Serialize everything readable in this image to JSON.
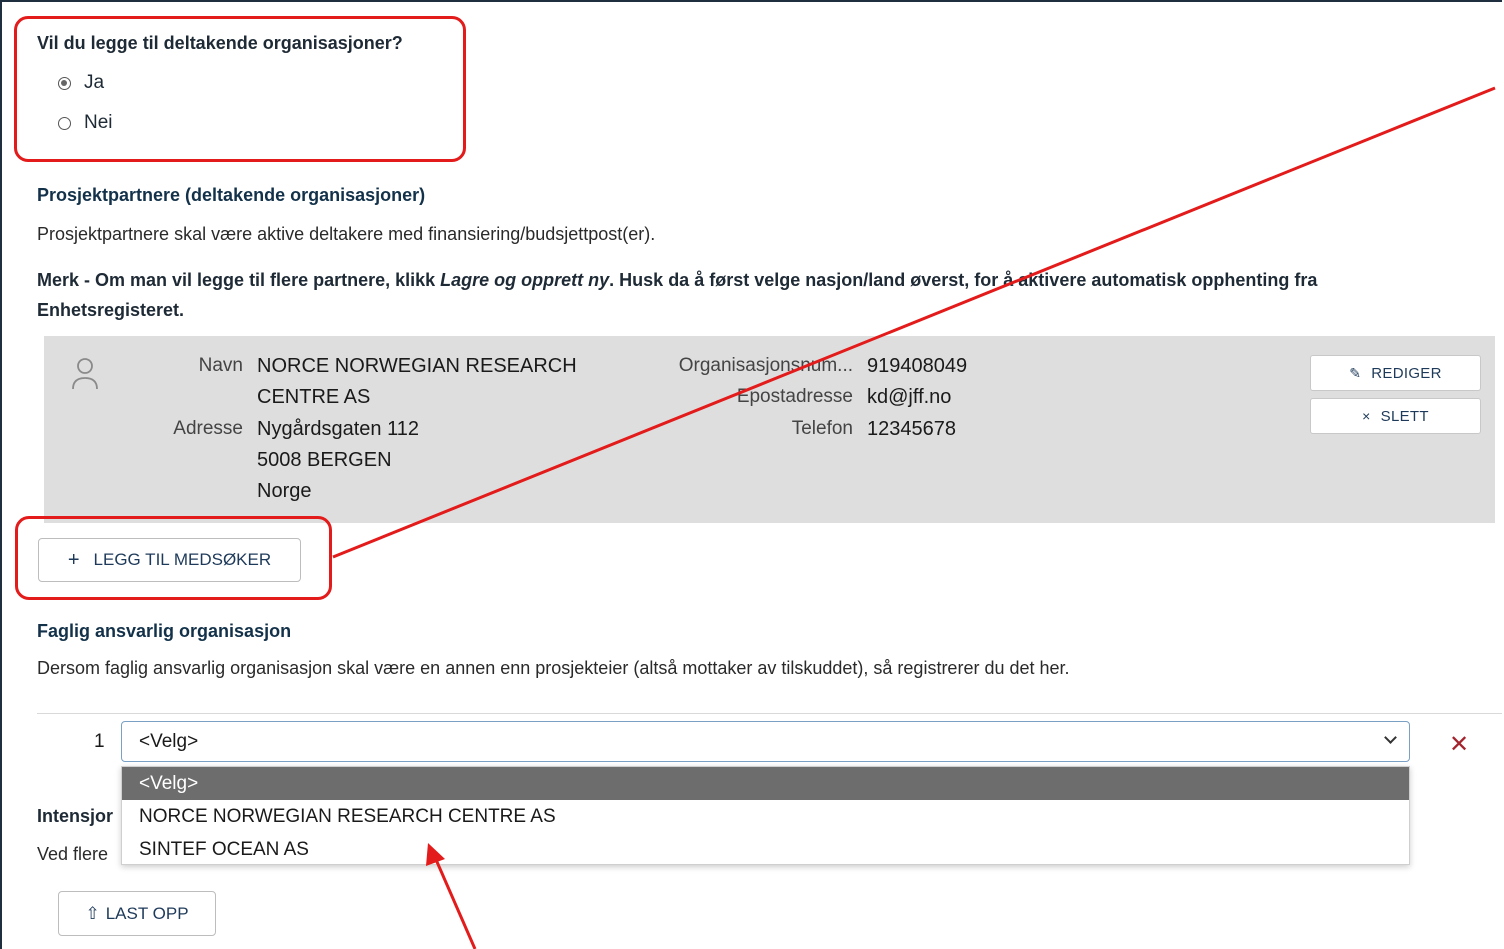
{
  "question": {
    "title": "Vil du legge til deltakende organisasjoner?",
    "options": [
      {
        "label": "Ja",
        "checked": true
      },
      {
        "label": "Nei",
        "checked": false
      }
    ]
  },
  "partners": {
    "heading": "Prosjektpartnere (deltakende organisasjoner)",
    "description": "Prosjektpartnere skal være aktive deltakere med finansiering/budsjettpost(er).",
    "note_prefix": "Merk - Om man vil legge til flere partnere, klikk ",
    "note_emphasis": "Lagre og opprett ny",
    "note_suffix": ". Husk da å først velge nasjon/land øverst, for å aktivere automatisk opphenting fra Enhetsregisteret.",
    "card": {
      "name_label": "Navn",
      "name_line1": "NORCE NORWEGIAN RESEARCH",
      "name_line2": "CENTRE AS",
      "address_label": "Adresse",
      "address_line1": "Nygårdsgaten 112",
      "address_line2": "5008 BERGEN",
      "address_line3": "Norge",
      "orgnum_label": "Organisasjonsnum...",
      "orgnum_value": "919408049",
      "email_label": "Epostadresse",
      "email_value": "kd@jff.no",
      "phone_label": "Telefon",
      "phone_value": "12345678",
      "edit_label": "REDIGER",
      "delete_label": "SLETT"
    },
    "add_button": "LEGG TIL MEDSØKER"
  },
  "responsible": {
    "heading": "Faglig ansvarlig organisasjon",
    "description": "Dersom faglig ansvarlig organisasjon skal være en annen enn prosjekteier (altså mottaker av tilskuddet), så registrerer du det her.",
    "row_number": "1",
    "select_value": "<Velg>",
    "options": [
      "<Velg>",
      "NORCE NORWEGIAN RESEARCH CENTRE AS",
      "SINTEF OCEAN AS"
    ],
    "remove_symbol": "✕"
  },
  "intent": {
    "heading_visible": "Intensjor",
    "text_visible": "Ved flere",
    "upload_label": "LAST OPP"
  },
  "colors": {
    "highlight": "#e31b1b",
    "card_bg": "#dedede",
    "heading": "#13324a",
    "remove": "#a4242e"
  }
}
